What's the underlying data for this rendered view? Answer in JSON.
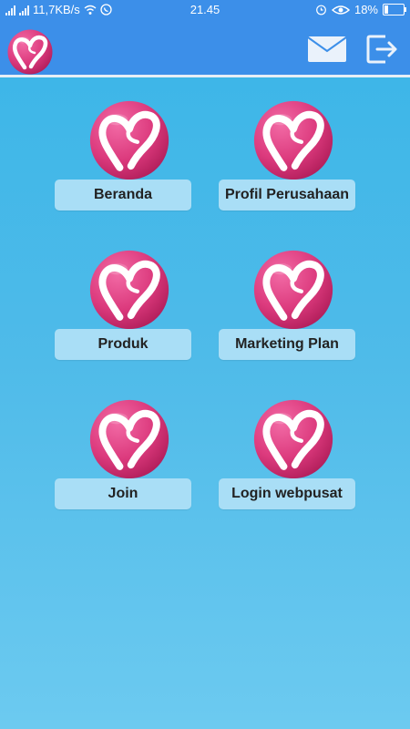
{
  "status_bar": {
    "network_speed": "11,7KB/s",
    "time": "21.45",
    "battery_percent": "18%",
    "battery_level": 0.18
  },
  "app_bar": {
    "logo_icon": "heart-ribbon-logo",
    "mail_icon": "envelope-icon",
    "logout_icon": "exit-icon"
  },
  "menu": {
    "items": [
      {
        "label": "Beranda",
        "icon": "heart-ribbon-logo"
      },
      {
        "label": "Profil Perusahaan",
        "icon": "heart-ribbon-logo"
      },
      {
        "label": "Produk",
        "icon": "heart-ribbon-logo"
      },
      {
        "label": "Marketing Plan",
        "icon": "heart-ribbon-logo"
      },
      {
        "label": "Join",
        "icon": "heart-ribbon-logo"
      },
      {
        "label": "Login webpusat",
        "icon": "heart-ribbon-logo"
      }
    ]
  },
  "colors": {
    "app_bar": "#3c8fe9",
    "background_top": "#39b5e8",
    "background_bottom": "#6ccaf0",
    "tile_label": "#a9def6",
    "logo_pink": "#d93a7c"
  }
}
